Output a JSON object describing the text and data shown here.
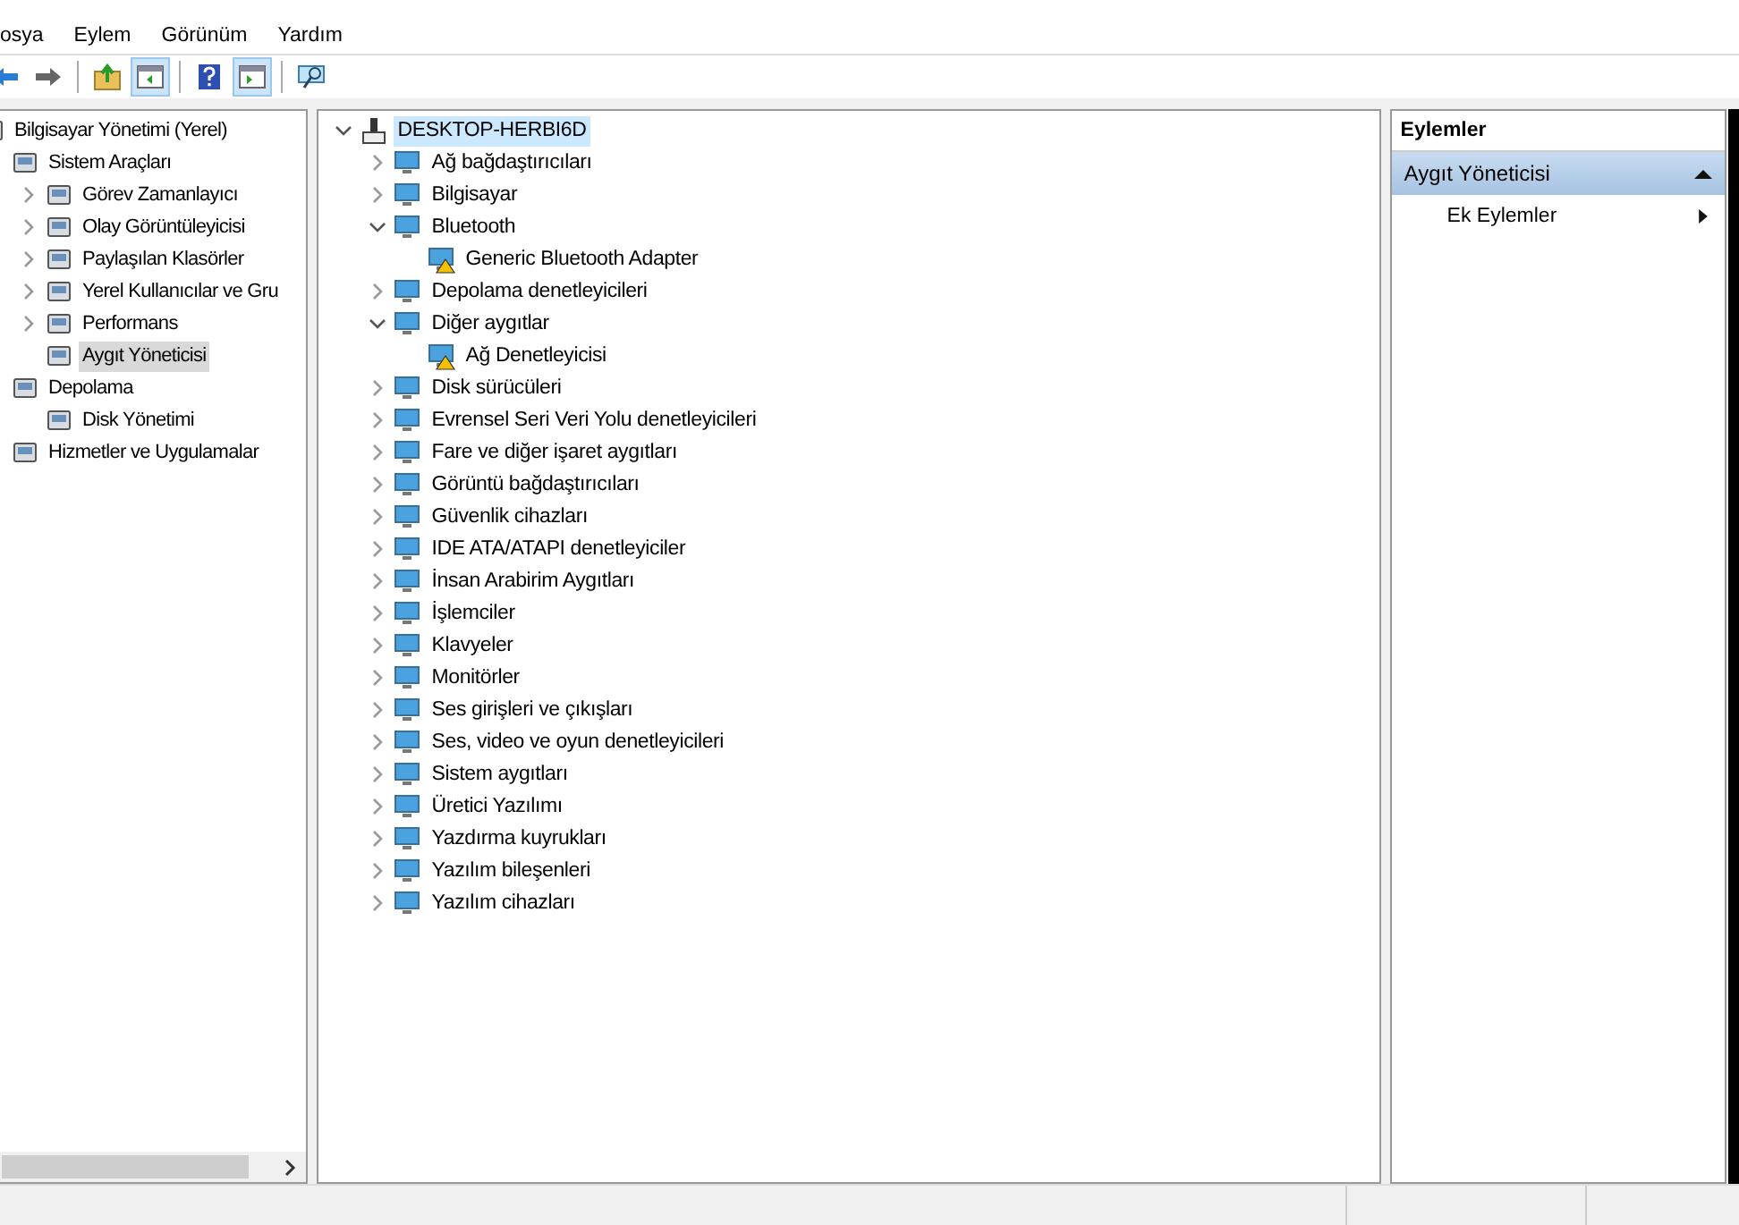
{
  "menu_bar": [
    "osya",
    "Eylem",
    "Görünüm",
    "Yardım"
  ],
  "toolbar": [
    {
      "kind": "back",
      "pressed": false
    },
    {
      "kind": "forward",
      "pressed": false
    },
    {
      "kind": "sep"
    },
    {
      "kind": "up",
      "pressed": false
    },
    {
      "kind": "tree",
      "pressed": true
    },
    {
      "kind": "sep"
    },
    {
      "kind": "help",
      "pressed": false
    },
    {
      "kind": "pane",
      "pressed": true
    },
    {
      "kind": "sep"
    },
    {
      "kind": "find",
      "pressed": false
    }
  ],
  "console_tree": [
    {
      "label": "Bilgisayar Yönetimi (Yerel)",
      "selected": false,
      "children": [
        {
          "label": "Sistem Araçları",
          "selected": false,
          "children": [
            {
              "label": "Görev Zamanlayıcı",
              "selected": false,
              "expanded": false
            },
            {
              "label": "Olay Görüntüleyicisi",
              "selected": false,
              "expanded": false
            },
            {
              "label": "Paylaşılan Klasörler",
              "selected": false,
              "expanded": false
            },
            {
              "label": "Yerel Kullanıcılar ve Gru",
              "selected": false,
              "expanded": false
            },
            {
              "label": "Performans",
              "selected": false,
              "expanded": false
            },
            {
              "label": "Aygıt Yöneticisi",
              "selected": true
            }
          ]
        },
        {
          "label": "Depolama",
          "selected": false,
          "children": [
            {
              "label": "Disk Yönetimi",
              "selected": false
            }
          ]
        },
        {
          "label": "Hizmetler ve Uygulamalar",
          "selected": false
        }
      ]
    }
  ],
  "device_tree": {
    "label": "DESKTOP-HERBI6D",
    "selected": true,
    "expanded": true,
    "children": [
      {
        "label": "Ağ bağdaştırıcıları",
        "expanded": false
      },
      {
        "label": "Bilgisayar",
        "expanded": false
      },
      {
        "label": "Bluetooth",
        "expanded": true,
        "children": [
          {
            "label": "Generic Bluetooth Adapter",
            "warning": true
          }
        ]
      },
      {
        "label": "Depolama denetleyicileri",
        "expanded": false
      },
      {
        "label": "Diğer aygıtlar",
        "expanded": true,
        "children": [
          {
            "label": "Ağ Denetleyicisi",
            "warning": true
          }
        ]
      },
      {
        "label": "Disk sürücüleri",
        "expanded": false
      },
      {
        "label": "Evrensel Seri Veri Yolu denetleyicileri",
        "expanded": false
      },
      {
        "label": "Fare ve diğer işaret aygıtları",
        "expanded": false
      },
      {
        "label": "Görüntü bağdaştırıcıları",
        "expanded": false
      },
      {
        "label": "Güvenlik cihazları",
        "expanded": false
      },
      {
        "label": "IDE ATA/ATAPI denetleyiciler",
        "expanded": false
      },
      {
        "label": "İnsan Arabirim Aygıtları",
        "expanded": false
      },
      {
        "label": "İşlemciler",
        "expanded": false
      },
      {
        "label": "Klavyeler",
        "expanded": false
      },
      {
        "label": "Monitörler",
        "expanded": false
      },
      {
        "label": "Ses girişleri ve çıkışları",
        "expanded": false
      },
      {
        "label": "Ses, video ve oyun denetleyicileri",
        "expanded": false
      },
      {
        "label": "Sistem aygıtları",
        "expanded": false
      },
      {
        "label": "Üretici Yazılımı",
        "expanded": false
      },
      {
        "label": "Yazdırma kuyrukları",
        "expanded": false
      },
      {
        "label": "Yazılım bileşenleri",
        "expanded": false
      },
      {
        "label": "Yazılım cihazları",
        "expanded": false
      }
    ]
  },
  "actions_pane": {
    "title": "Eylemler",
    "sections": [
      {
        "title": "Aygıt Yöneticisi",
        "expanded": true,
        "items": [
          "Ek Eylemler"
        ]
      }
    ]
  }
}
